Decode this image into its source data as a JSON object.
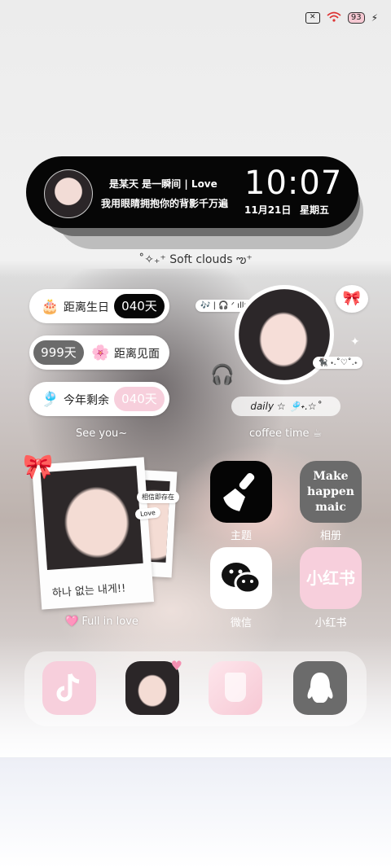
{
  "status": {
    "no_sim_icon": "no-sim-icon",
    "wifi_icon": "wifi-icon",
    "battery": "93",
    "charging_icon": "charging-icon"
  },
  "clock_widget": {
    "line1": "是某天 是一瞬间 | Love",
    "line2": "我用眼睛拥抱你的背影千万遍",
    "time": "10:07",
    "date": "11月21日",
    "weekday": "星期五"
  },
  "tagline": "˚✧₊⁺ Soft clouds ఌ⁺",
  "countdowns": [
    {
      "emoji": "🎂",
      "label": "距离生日",
      "value": "040天"
    },
    {
      "emoji": "🌸",
      "label": "距离见面",
      "value": "999天"
    },
    {
      "emoji": "🎐",
      "label": "今年剩余",
      "value": "040天"
    }
  ],
  "see_you": "See you~",
  "coffee_time": "coffee time ☕",
  "music_tag": "🎶 | 🎧 ᐟ ıllıllı ♪",
  "cat_tag": "🐈‍⬛ ˖.˚♡˚.˖",
  "daily": "daily ☆ 🎐˖.☆˚",
  "bow_icon": "bow-icon",
  "polaroid": {
    "note": "相信即存在",
    "love_tag": "Love",
    "handwriting": "하나 없는 내게!!",
    "caption": "🩷 Full in love"
  },
  "apps": [
    {
      "label": "主题",
      "icon": "paintbrush-icon"
    },
    {
      "label": "相册",
      "icon_text": "Make happen maic"
    },
    {
      "label": "微信",
      "icon": "wechat-icon"
    },
    {
      "label": "小红书",
      "icon_text": "小红书"
    }
  ],
  "dock": [
    {
      "name": "tiktok",
      "icon": "tiktok-icon"
    },
    {
      "name": "photo-app",
      "icon": "photo-icon"
    },
    {
      "name": "drink-app",
      "icon": "drink-icon"
    },
    {
      "name": "qq",
      "icon": "penguin-icon"
    }
  ],
  "colors": {
    "pink": "#f7cfdc",
    "dark": "#060606",
    "grey_pill": "#6b6b6b"
  }
}
